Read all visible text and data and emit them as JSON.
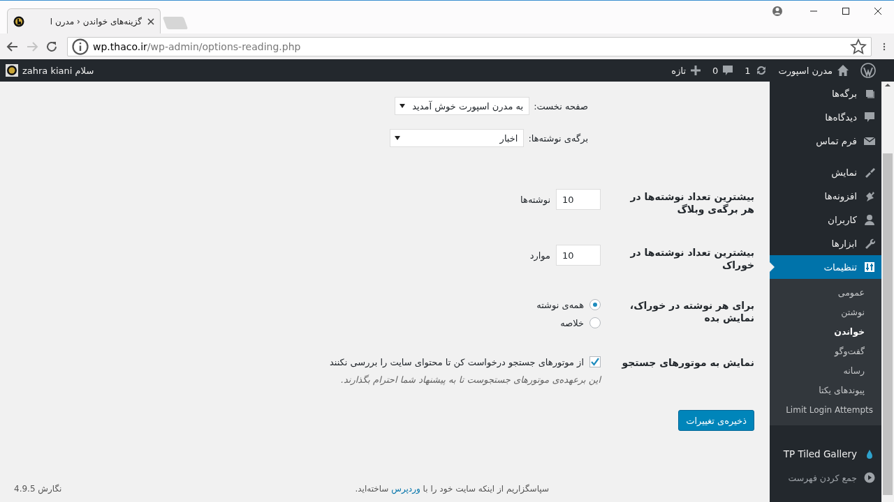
{
  "browser": {
    "tab_title": "گزینه‌های خواندن ‹ مدرن ا",
    "url_host": "wp.thaco.ir",
    "url_path": "/wp-admin/options-reading.php"
  },
  "admin_bar": {
    "greeting": "سلام",
    "user": "zahra kiani",
    "site": "مدرن اسپورت",
    "updates": "1",
    "comments": "0",
    "new": "تازه"
  },
  "sidebar": {
    "items": [
      {
        "label": "برگه‌ها",
        "selected": false
      },
      {
        "label": "دیدگاه‌ها",
        "selected": false
      },
      {
        "label": "فرم تماس",
        "selected": false
      },
      {
        "label": "نمایش",
        "selected": false
      },
      {
        "label": "افزونه‌ها",
        "selected": false
      },
      {
        "label": "کاربران",
        "selected": false
      },
      {
        "label": "ابزارها",
        "selected": false
      },
      {
        "label": "تنظیمات",
        "selected": true
      }
    ],
    "submenu": [
      {
        "label": "عمومی",
        "selected": false
      },
      {
        "label": "نوشتن",
        "selected": false
      },
      {
        "label": "خواندن",
        "selected": true
      },
      {
        "label": "گفت‌وگو",
        "selected": false
      },
      {
        "label": "رسانه",
        "selected": false
      },
      {
        "label": "پیوندهای یکتا",
        "selected": false
      },
      {
        "label": "Limit Login Attempts",
        "selected": false
      }
    ],
    "gallery": "TP Tiled Gallery",
    "collapse": "جمع کردن فهرست"
  },
  "form": {
    "front_page": {
      "label": "صفحه نخست:",
      "value": "به مدرن اسپورت خوش آمدید"
    },
    "posts_page": {
      "label": "برگه‌ی نوشته‌ها:",
      "value": "اخبار"
    },
    "blog_pages": {
      "label": "بیشترین تعداد نوشته‌ها در هر برگه‌ی وبلاگ",
      "value": "10",
      "unit": "نوشته‌ها"
    },
    "feed_items": {
      "label": "بیشترین تعداد نوشته‌ها در خوراک",
      "value": "10",
      "unit": "موارد"
    },
    "feed_show": {
      "label": "برای هر نوشته در خوراک، نمایش بده",
      "options": [
        {
          "label": "همه‌ی نوشته",
          "selected": true
        },
        {
          "label": "خلاصه",
          "selected": false
        }
      ]
    },
    "visibility": {
      "label": "نمایش به موتورهای جستجو",
      "checkbox": "از موتورهای جستجو درخواست کن تا محتوای سایت را بررسی نکنند",
      "checked": true,
      "description": "این برعهده‌ی موتورهای جستجوست تا به پیشنهاد شما احترام بگذارند."
    },
    "save": "ذخیره‌ی تغییرات"
  },
  "footer": {
    "thanks": "سپاسگزاریم از اینکه سایت خود را با",
    "link": "وردپرس",
    "thanks_end": "ساخته‌اید.",
    "version": "نگارش 4.9.5"
  }
}
